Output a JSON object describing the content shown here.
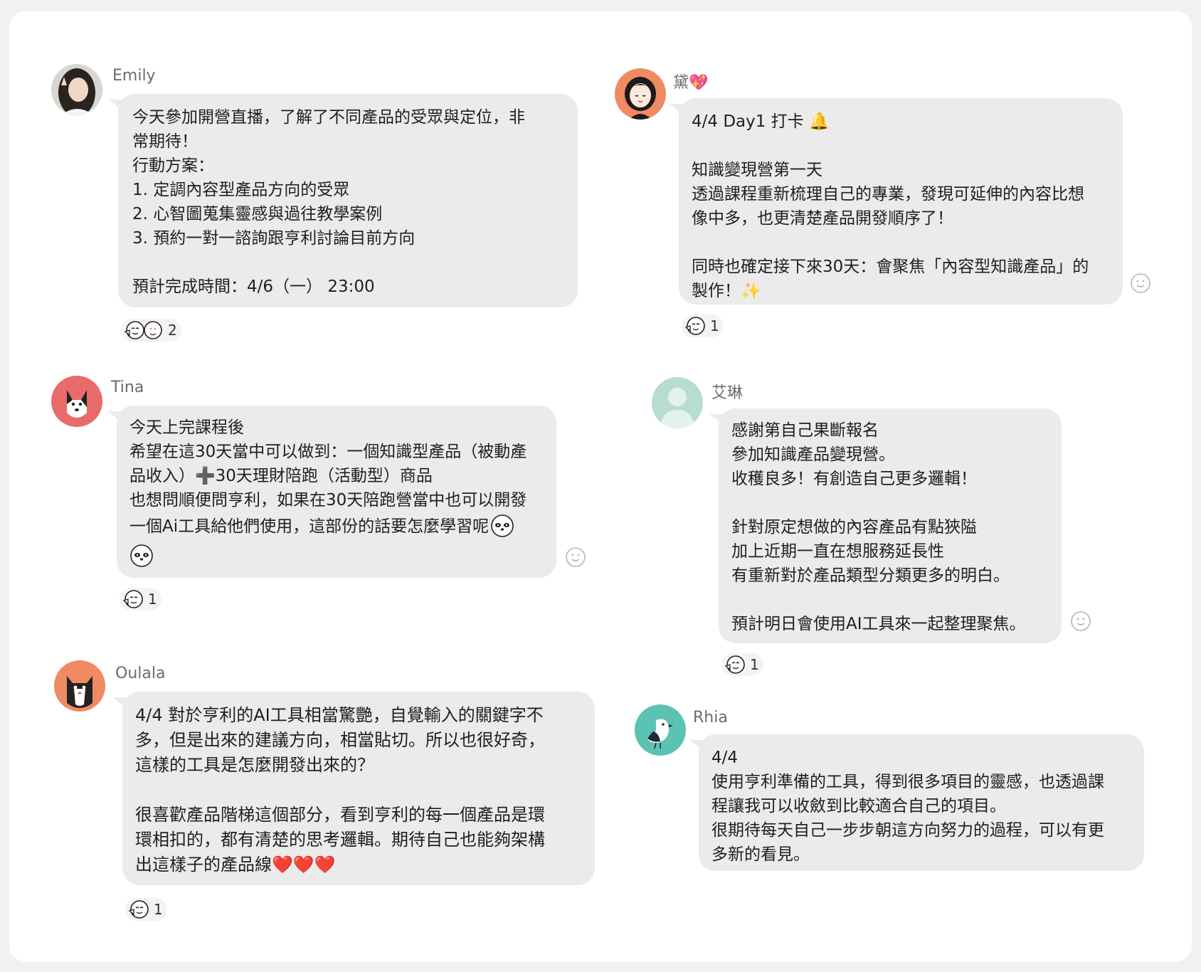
{
  "messages": [
    {
      "id": "emily",
      "name": "Emily",
      "lines": [
        "今天參加開營直播，了解了不同產品的受眾與定位，非",
        "常期待！",
        "行動方案：",
        "1. 定調內容型產品方向的受眾",
        "2. 心智圖蒐集靈感與過往教學案例",
        "3. 預約一對一諮詢跟亨利討論目前方向",
        "",
        "預計完成時間：4/6（一） 23:00"
      ],
      "reactions": [
        "pointing-face-emoji",
        "heart-eyes-emoji"
      ],
      "reaction_count": "2"
    },
    {
      "id": "dai",
      "name": "黛💖",
      "lines": [
        "4/4 Day1 打卡 🔔",
        "",
        "知識變現營第一天",
        "透過課程重新梳理自己的專業，發現可延伸的內容比想",
        "像中多，也更清楚產品開發順序了！",
        "",
        "同時也確定接下來30天：會聚焦「內容型知識產品」的",
        "製作！✨"
      ],
      "reactions": [
        "pointing-face-emoji"
      ],
      "reaction_count": "1"
    },
    {
      "id": "tina",
      "name": "Tina",
      "lines": [
        "今天上完課程後",
        "希望在這30天當中可以做到：一個知識型產品（被動產",
        "品收入）➕30天理財陪跑（活動型）商品",
        "也想問順便問亨利，如果在30天陪跑營當中也可以開發",
        "一個Ai工具給他們使用，這部份的話要怎麼學習呢"
      ],
      "reactions": [
        "pointing-face-emoji"
      ],
      "reaction_count": "1"
    },
    {
      "id": "ailin",
      "name": "艾琳",
      "lines": [
        "感謝第自己果斷報名",
        "參加知識產品變現營。",
        "收穫良多！有創造自己更多邏輯！",
        "",
        "針對原定想做的內容產品有點狹隘",
        "加上近期一直在想服務延長性",
        "有重新對於產品類型分類更多的明白。",
        "",
        "預計明日會使用AI工具來一起整理聚焦。"
      ],
      "reactions": [
        "pointing-face-emoji"
      ],
      "reaction_count": "1"
    },
    {
      "id": "oulala",
      "name": "Oulala",
      "lines": [
        "4/4 對於亨利的AI工具相當驚艷，自覺輸入的關鍵字不",
        "多，但是出來的建議方向，相當貼切。所以也很好奇，",
        "這樣的工具是怎麼開發出來的？",
        "",
        "很喜歡產品階梯這個部分，看到亨利的每一個產品是環",
        "環相扣的，都有清楚的思考邏輯。期待自己也能夠架構",
        "出這樣子的產品線❤️❤️❤️"
      ],
      "reactions": [
        "pointing-face-emoji"
      ],
      "reaction_count": "1"
    },
    {
      "id": "rhia",
      "name": "Rhia",
      "lines": [
        "4/4",
        "使用亨利準備的工具，得到很多項目的靈感，也透過課",
        "程讓我可以收斂到比較適合自己的項目。",
        "很期待每天自己一步步朝這方向努力的過程，可以有更",
        "多新的看見。"
      ],
      "reactions": [],
      "reaction_count": ""
    }
  ],
  "icons": {
    "add_reaction": "smiley-outline-icon",
    "sticker": "panda-face-emoji"
  },
  "colors": {
    "bubble": "#ebebeb",
    "name": "#6b6b6b",
    "avatar_dai": "#f08a62",
    "avatar_tina": "#e96b6b",
    "avatar_ailin": "#b8ddd0",
    "avatar_oulala": "#f08a62",
    "avatar_rhia": "#5cc3b4"
  }
}
